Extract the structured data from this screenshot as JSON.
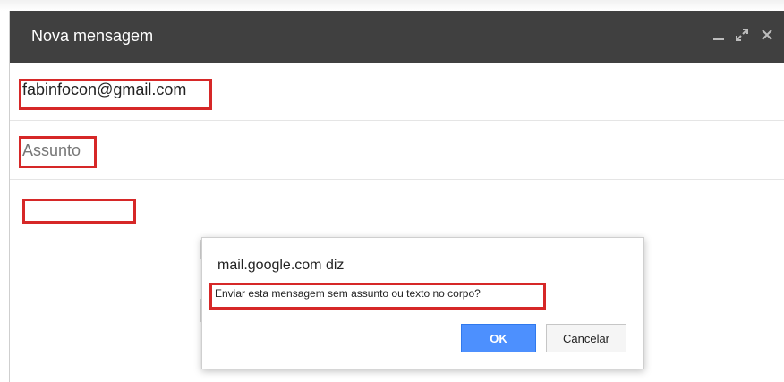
{
  "compose": {
    "title": "Nova mensagem",
    "controls": {
      "minimize_icon": "minimize-icon",
      "expand_icon": "expand-icon",
      "close_icon": "close-icon"
    },
    "to_value": "fabinfocon@gmail.com",
    "subject_placeholder": "Assunto",
    "body_value": ""
  },
  "dialog": {
    "title": "mail.google.com diz",
    "message": "Enviar esta mensagem sem assunto ou texto no corpo?",
    "ok_label": "OK",
    "cancel_label": "Cancelar"
  },
  "colors": {
    "titlebar": "#404040",
    "highlight": "#d62828",
    "primary_button": "#4d90fe"
  }
}
